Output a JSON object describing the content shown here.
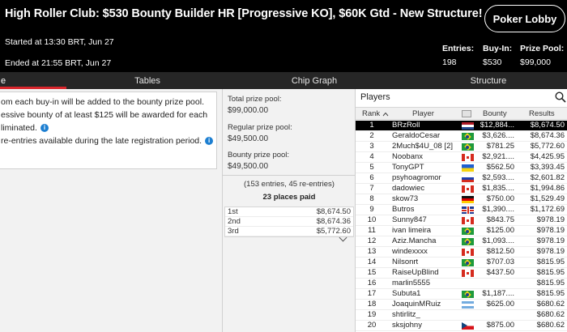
{
  "header": {
    "title": "High Roller Club: $530 Bounty Builder HR [Progressive KO], $60K Gtd - New Structure!",
    "lobby_button": "Poker Lobby",
    "started": "Started at 13:30 BRT, Jun 27",
    "ended": "Ended at 21:55 BRT, Jun 27",
    "stats": [
      {
        "label": "Entries:",
        "value": "198"
      },
      {
        "label": "Buy-In:",
        "value": "$530"
      },
      {
        "label": "Prize Pool:",
        "value": "$99,000"
      }
    ]
  },
  "tabs": [
    {
      "label": "e"
    },
    {
      "label": "Tables"
    },
    {
      "label": "Chip Graph"
    },
    {
      "label": "Structure"
    }
  ],
  "info": {
    "line1": "om each buy-in will be added to the bounty prize pool.",
    "line2": "essive bounty of at least $125 will be awarded for each",
    "line3": "liminated.",
    "line4": "re-entries available during the late registration period."
  },
  "prize": {
    "total_label": "Total prize pool:",
    "total_value": "$99,000.00",
    "regular_label": "Regular prize pool:",
    "regular_value": "$49,500.00",
    "bounty_label": "Bounty prize pool:",
    "bounty_value": "$49,500.00",
    "entries_note": "(153 entries, 45 re-entries)",
    "places_paid": "23 places paid",
    "payouts": [
      {
        "place": "1st",
        "amount": "$8,674.50"
      },
      {
        "place": "2nd",
        "amount": "$8,674.36"
      },
      {
        "place": "3rd",
        "amount": "$5,772.60"
      }
    ]
  },
  "players": {
    "title": "Players",
    "columns": {
      "rank": "Rank",
      "player": "Player",
      "bounty": "Bounty",
      "results": "Results"
    },
    "rows": [
      {
        "rank": "1",
        "name": "BRzRoll",
        "flag": "nl",
        "bounty": "$12,884...",
        "results": "$8,674.50",
        "selected": true
      },
      {
        "rank": "2",
        "name": "GeraldoCesar",
        "flag": "br",
        "bounty": "$3,626....",
        "results": "$8,674.36"
      },
      {
        "rank": "3",
        "name": "2Much$4U_08 [2]",
        "flag": "br",
        "bounty": "$781.25",
        "results": "$5,772.60"
      },
      {
        "rank": "4",
        "name": "Noobanx",
        "flag": "ca",
        "bounty": "$2,921....",
        "results": "$4,425.95"
      },
      {
        "rank": "5",
        "name": "TonyGPT",
        "flag": "ua",
        "bounty": "$562.50",
        "results": "$3,393.45"
      },
      {
        "rank": "6",
        "name": "psyhoagromor",
        "flag": "ru",
        "bounty": "$2,593....",
        "results": "$2,601.82"
      },
      {
        "rank": "7",
        "name": "dadowiec",
        "flag": "ca",
        "bounty": "$1,835....",
        "results": "$1,994.86"
      },
      {
        "rank": "8",
        "name": "skow73",
        "flag": "de",
        "bounty": "$750.00",
        "results": "$1,529.49"
      },
      {
        "rank": "9",
        "name": "Butros",
        "flag": "gb",
        "bounty": "$1,390....",
        "results": "$1,172.69"
      },
      {
        "rank": "10",
        "name": "Sunny847",
        "flag": "ca",
        "bounty": "$843.75",
        "results": "$978.19"
      },
      {
        "rank": "11",
        "name": "ivan limeira",
        "flag": "br",
        "bounty": "$125.00",
        "results": "$978.19"
      },
      {
        "rank": "12",
        "name": "Aziz.Mancha",
        "flag": "br",
        "bounty": "$1,093....",
        "results": "$978.19"
      },
      {
        "rank": "13",
        "name": "windexxxx",
        "flag": "ca",
        "bounty": "$812.50",
        "results": "$978.19"
      },
      {
        "rank": "14",
        "name": "Nilsonrt",
        "flag": "br",
        "bounty": "$707.03",
        "results": "$815.95"
      },
      {
        "rank": "15",
        "name": "RaiseUpBlind",
        "flag": "ca",
        "bounty": "$437.50",
        "results": "$815.95"
      },
      {
        "rank": "16",
        "name": "marlin5555",
        "flag": "none",
        "bounty": "",
        "results": "$815.95"
      },
      {
        "rank": "17",
        "name": "Subuta1",
        "flag": "br",
        "bounty": "$1,187....",
        "results": "$815.95"
      },
      {
        "rank": "18",
        "name": "JoaquinMRuiz",
        "flag": "ar",
        "bounty": "$625.00",
        "results": "$680.62"
      },
      {
        "rank": "19",
        "name": "shtirlitz_",
        "flag": "none",
        "bounty": "",
        "results": "$680.62"
      },
      {
        "rank": "20",
        "name": "sksjohny",
        "flag": "cz",
        "bounty": "$875.00",
        "results": "$680.62"
      }
    ]
  },
  "colors": {
    "accent": "#d9262c",
    "header_bg": "#000000",
    "tabs_bg": "#262626",
    "info_icon": "#1d7fd1"
  },
  "icons": [
    "info-icon",
    "search-icon",
    "sort-up-icon",
    "flag-icon",
    "chevron-down-icon"
  ]
}
